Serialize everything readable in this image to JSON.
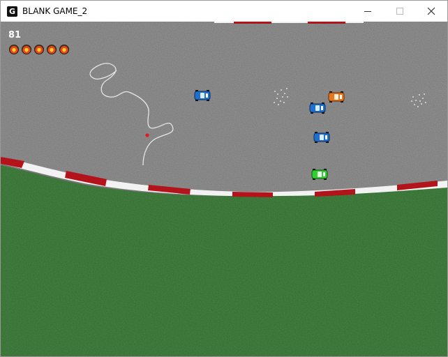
{
  "window": {
    "title": "BLANK GAME_2",
    "icon": "game-maker-icon",
    "controls": [
      "minimize-icon",
      "maximize-icon",
      "close-icon"
    ]
  },
  "hud": {
    "score": "81",
    "lives": 5
  },
  "scene": {
    "track_color": "#7a7a7a",
    "grass_color": "#2f6b2b",
    "kerb_colors": [
      "#b3141b",
      "#f2f2f2"
    ],
    "player_car": "green",
    "cars": [
      "blue",
      "blue",
      "blue",
      "orange",
      "green"
    ]
  }
}
